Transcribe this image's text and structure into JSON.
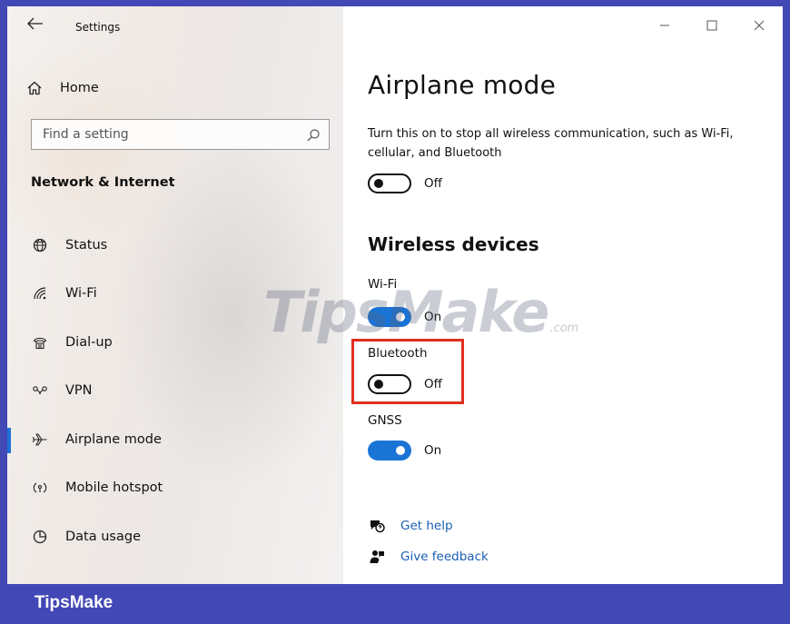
{
  "window": {
    "title": "Settings",
    "controls": {
      "minimize": "—",
      "maximize": "☐",
      "close": "✕"
    }
  },
  "sidebar": {
    "home": {
      "label": "Home",
      "icon": "home-icon"
    },
    "search": {
      "placeholder": "Find a setting",
      "value": ""
    },
    "section_title": "Network & Internet",
    "items": [
      {
        "label": "Status",
        "icon": "globe-icon",
        "selected": false
      },
      {
        "label": "Wi-Fi",
        "icon": "wifi-icon",
        "selected": false
      },
      {
        "label": "Dial-up",
        "icon": "dialup-icon",
        "selected": false
      },
      {
        "label": "VPN",
        "icon": "vpn-icon",
        "selected": false
      },
      {
        "label": "Airplane mode",
        "icon": "airplane-icon",
        "selected": true
      },
      {
        "label": "Mobile hotspot",
        "icon": "hotspot-icon",
        "selected": false
      },
      {
        "label": "Data usage",
        "icon": "data-usage-icon",
        "selected": false
      }
    ]
  },
  "main": {
    "title": "Airplane mode",
    "description": "Turn this on to stop all wireless communication, such as Wi-Fi, cellular, and Bluetooth",
    "airplane_toggle": {
      "state": "Off",
      "on": false
    },
    "wireless_title": "Wireless devices",
    "devices": [
      {
        "label": "Wi-Fi",
        "state": "On",
        "on": true
      },
      {
        "label": "Bluetooth",
        "state": "Off",
        "on": false
      },
      {
        "label": "GNSS",
        "state": "On",
        "on": true
      }
    ],
    "links": [
      {
        "label": "Get help",
        "icon": "help-icon"
      },
      {
        "label": "Give feedback",
        "icon": "feedback-icon"
      }
    ]
  },
  "watermark": {
    "text": "TipsMake",
    "suffix": ".com"
  },
  "footer": {
    "brand": "TipsMake"
  },
  "colors": {
    "accent": "#1a74d6",
    "link": "#1a5fb4",
    "highlight": "#e0301e",
    "frame": "#4248b6"
  }
}
